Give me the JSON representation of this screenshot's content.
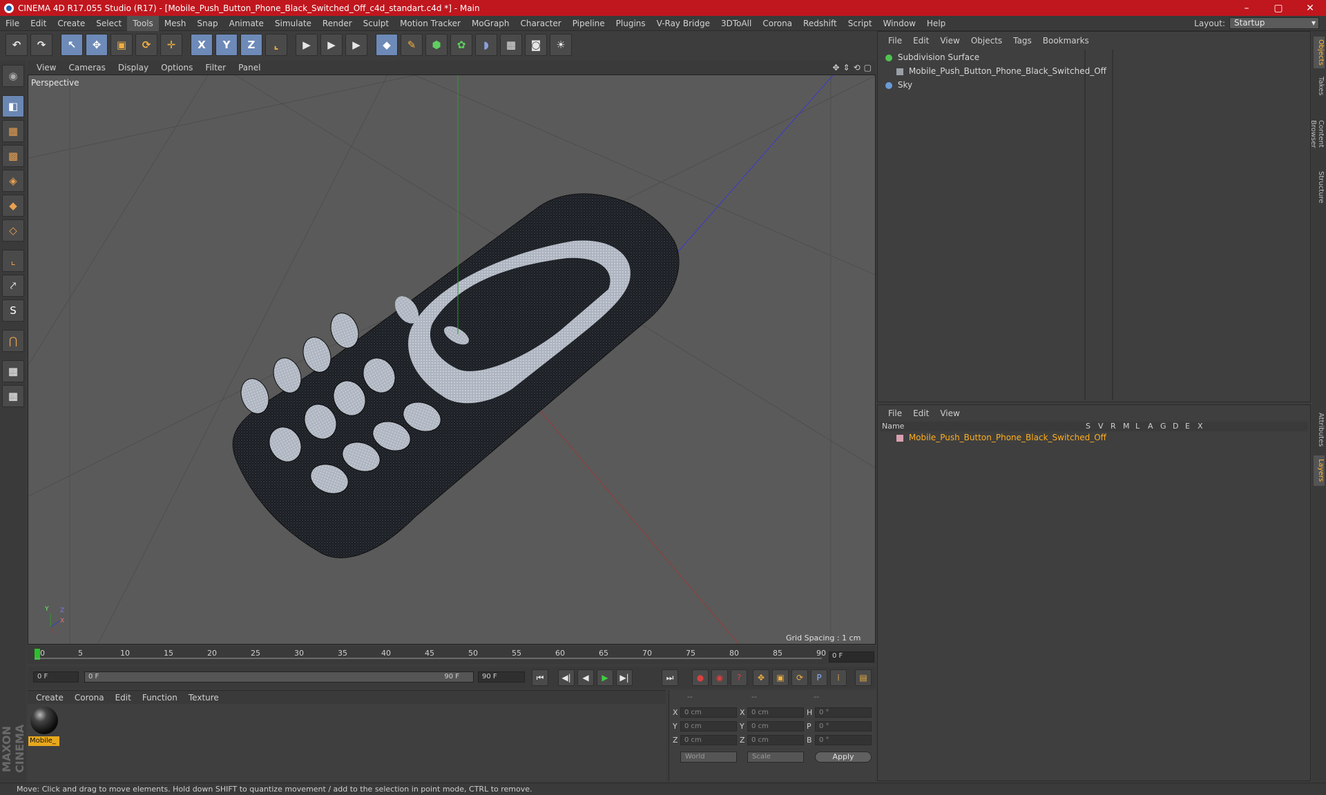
{
  "window": {
    "title": "CINEMA 4D R17.055 Studio (R17) - [Mobile_Push_Button_Phone_Black_Switched_Off_c4d_standart.c4d *] - Main",
    "controls": [
      "–",
      "▢",
      "✕"
    ]
  },
  "menubar": {
    "items": [
      "File",
      "Edit",
      "Create",
      "Select",
      "Tools",
      "Mesh",
      "Snap",
      "Animate",
      "Simulate",
      "Render",
      "Sculpt",
      "Motion Tracker",
      "MoGraph",
      "Character",
      "Pipeline",
      "Plugins",
      "V-Ray Bridge",
      "3DToAll",
      "Corona",
      "Redshift",
      "Script",
      "Window",
      "Help"
    ],
    "active": "Tools",
    "layout_label": "Layout:",
    "layout_value": "Startup"
  },
  "toolbar": {
    "undo": "↶",
    "redo": "↷",
    "select": "↖",
    "move": "✥",
    "scale": "▣",
    "rotate": "⟳",
    "live": "✛",
    "x": "X",
    "y": "Y",
    "z": "Z",
    "coord": "⌞",
    "render1": "▶",
    "render2": "▶",
    "render3": "▶",
    "cube": "◆",
    "pen": "✎",
    "subdiv": "⬢",
    "mograph": "✿",
    "deform": "◗",
    "floor": "▦",
    "camera": "◙",
    "light": "☀"
  },
  "lefttools": [
    "◉",
    "◧",
    "▦",
    "▩",
    "◈",
    "◆",
    "◇",
    "⌞",
    "⤤",
    "S",
    "⋂",
    "▦",
    "▦"
  ],
  "branding": "MAXON CINEMA 4D",
  "viewport": {
    "menu": [
      "View",
      "Cameras",
      "Display",
      "Options",
      "Filter",
      "Panel"
    ],
    "nav_icons": [
      "✥",
      "⇕",
      "⟲",
      "▢"
    ],
    "label": "Perspective",
    "grid_spacing": "Grid Spacing : 1 cm",
    "axis_labels": [
      "Y",
      "X",
      "Z"
    ]
  },
  "timeline": {
    "ticks": [
      "0",
      "5",
      "10",
      "15",
      "20",
      "25",
      "30",
      "35",
      "40",
      "45",
      "50",
      "55",
      "60",
      "65",
      "70",
      "75",
      "80",
      "85",
      "90"
    ],
    "current_frame": "0 F"
  },
  "transport": {
    "start_field": "0 F",
    "range_start": "0 F",
    "range_end": "90 F",
    "end_field": "90 F",
    "buttons": [
      "⏮",
      "◀|",
      "◀",
      "▶",
      "▶|",
      "⏭"
    ]
  },
  "material_manager": {
    "menu": [
      "Create",
      "Corona",
      "Edit",
      "Function",
      "Texture"
    ],
    "material_name": "Mobile_"
  },
  "coordinates": {
    "header": [
      "--",
      "--",
      "--"
    ],
    "rows": [
      {
        "axis": "X",
        "pos": "0 cm",
        "axis2": "X",
        "size": "0 cm",
        "rot_label": "H",
        "rot": "0 °"
      },
      {
        "axis": "Y",
        "pos": "0 cm",
        "axis2": "Y",
        "size": "0 cm",
        "rot_label": "P",
        "rot": "0 °"
      },
      {
        "axis": "Z",
        "pos": "0 cm",
        "axis2": "Z",
        "size": "0 cm",
        "rot_label": "B",
        "rot": "0 °"
      }
    ],
    "mode1": "World",
    "mode2": "Scale",
    "apply": "Apply"
  },
  "object_manager": {
    "menu": [
      "File",
      "Edit",
      "View",
      "Objects",
      "Tags",
      "Bookmarks"
    ],
    "objects": [
      {
        "name": "Subdivision Surface",
        "color": "#4fc44f"
      },
      {
        "name": "Mobile_Push_Button_Phone_Black_Switched_Off",
        "color": "#9aa0a8"
      },
      {
        "name": "Sky",
        "color": "#6a9ad6"
      }
    ]
  },
  "layer_manager": {
    "menu": [
      "File",
      "Edit",
      "View"
    ],
    "columns": [
      "Name",
      "S",
      "V",
      "R",
      "M",
      "L",
      "A",
      "G",
      "D",
      "E",
      "X"
    ],
    "layer": "Mobile_Push_Button_Phone_Black_Switched_Off"
  },
  "side_tabs": [
    "Objects",
    "Takes",
    "Content Browser",
    "Structure",
    "Attributes",
    "Layers"
  ],
  "status": "Move: Click and drag to move elements. Hold down SHIFT to quantize movement / add to the selection in point mode, CTRL to remove."
}
